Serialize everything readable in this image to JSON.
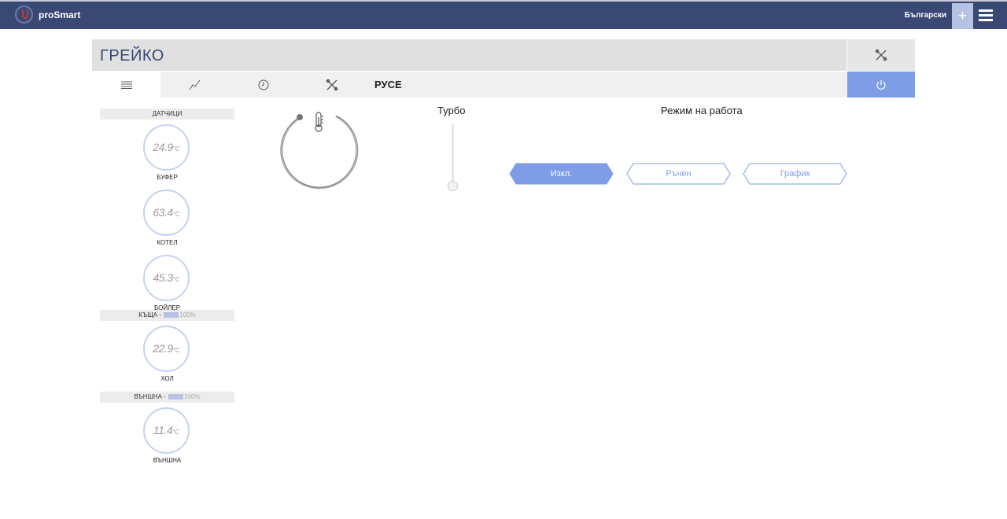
{
  "app": {
    "brand": "proSmart",
    "language": "Български",
    "plus": "+"
  },
  "panel": {
    "title": "ГРЕЙКО",
    "location": "РУСЕ"
  },
  "tabs": [
    {
      "icon": "list-icon"
    },
    {
      "icon": "chart-line-icon"
    },
    {
      "icon": "clock-icon"
    },
    {
      "icon": "tools-icon"
    }
  ],
  "sidebar": {
    "groups": [
      {
        "header": "ДАТЧИЦИ",
        "sensors": [
          {
            "value": "24.9",
            "unit": "°C",
            "label": "БУФЕР"
          },
          {
            "value": "63.4",
            "unit": "°C",
            "label": "КОТЕЛ"
          },
          {
            "value": "45.3",
            "unit": "°C",
            "label": "БОЙЛЕР"
          }
        ]
      },
      {
        "header": "КЪЩА -",
        "battery": "100%",
        "sensors": [
          {
            "value": "22.9",
            "unit": "°C",
            "label": "ХОЛ"
          }
        ]
      },
      {
        "header": "ВЪНШНА -",
        "battery": "100%",
        "sensors": [
          {
            "value": "11.4",
            "unit": "°C",
            "label": "ВЪНШНА"
          }
        ]
      }
    ]
  },
  "controls": {
    "turbo_label": "Турбо",
    "turbo_level": 0,
    "mode_label": "Режим на работа",
    "modes": [
      {
        "label": "Изкл.",
        "active": true
      },
      {
        "label": "Ръчен",
        "active": false
      },
      {
        "label": "График",
        "active": false
      }
    ]
  },
  "colors": {
    "topbar": "#3a4874",
    "accent": "#7e9de6",
    "accent_light": "#b6c2e4",
    "gauge_ring": "#c6d2ee"
  }
}
